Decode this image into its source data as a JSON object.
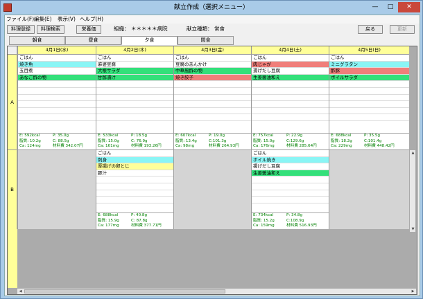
{
  "window": {
    "title": "献立作成（選択メニュー）",
    "minimize": "—",
    "maximize": "□",
    "close": "✕"
  },
  "menu": [
    "ファイル(F)",
    "編集(E)",
    "表示(V)",
    "ヘルプ(H)"
  ],
  "toolbar": {
    "register": "料理登録",
    "search": "料理検索",
    "nutrition": "栄養価",
    "org_label": "組織：",
    "org_value": "＊＊＊＊＊病院",
    "type_label": "献立種類：",
    "type_value": "常食",
    "back": "戻る",
    "update": "更新"
  },
  "tabs": [
    {
      "label": "朝食",
      "active": false
    },
    {
      "label": "昼食",
      "active": false
    },
    {
      "label": "夕食",
      "active": true
    },
    {
      "label": "間食",
      "active": false
    }
  ],
  "colors": {
    "cyan": "#8af5f5",
    "green": "#33e07a",
    "salmon": "#f07e7a",
    "yellow": "#ffff99",
    "nutrient_text": "#008000"
  },
  "days": [
    "4月1日(水)",
    "4月2日(木)",
    "4月3日(金)",
    "4月4日(土)",
    "4月5日(日)"
  ],
  "rows": [
    {
      "label": "A",
      "cells": [
        {
          "dishes": [
            {
              "name": "ごはん",
              "color": ""
            },
            {
              "name": "焼き魚",
              "color": "cyan"
            },
            {
              "name": "五目煮",
              "color": ""
            },
            {
              "name": "あなご酢の物",
              "color": "green"
            }
          ],
          "nutrients": {
            "e": "E:  592kcal",
            "p": "P:  35.0g",
            "fat": "脂質:  10.2g",
            "c": "C:  88.5g",
            "ca": "Ca:  124mg",
            "cost": "材料費 342.07円"
          }
        },
        {
          "dishes": [
            {
              "name": "ごはん",
              "color": ""
            },
            {
              "name": "麻婆豆腐",
              "color": ""
            },
            {
              "name": "大根サラダ",
              "color": "green"
            },
            {
              "name": "甘酢漬け",
              "color": "green"
            }
          ],
          "nutrients": {
            "e": "E:  533kcal",
            "p": "P:  18.5g",
            "fat": "脂質:  15.0g",
            "c": "C:  76.9g",
            "ca": "Ca:  161mg",
            "cost": "材料費 193.26円"
          }
        },
        {
          "dishes": [
            {
              "name": "ごはん",
              "color": ""
            },
            {
              "name": "豆腐のあんかけ",
              "color": ""
            },
            {
              "name": "中華風酢の物",
              "color": "green"
            },
            {
              "name": "焼き餃子",
              "color": "salmon"
            }
          ],
          "nutrients": {
            "e": "E:  607kcal",
            "p": "P:  19.0g",
            "fat": "脂質:  13.4g",
            "c": "C:101.3g",
            "ca": "Ca:   98mg",
            "cost": "材料費 264.93円"
          }
        },
        {
          "dishes": [
            {
              "name": "ごはん",
              "color": ""
            },
            {
              "name": "肉じゃが",
              "color": "salmon"
            },
            {
              "name": "揚げだし豆腐",
              "color": ""
            },
            {
              "name": "生姜醤油和え",
              "color": "green"
            }
          ],
          "nutrients": {
            "e": "E:  757kcal",
            "p": "P:  22.9g",
            "fat": "脂質:  15.0g",
            "c": "C:129.6g",
            "ca": "Ca:  176mg",
            "cost": "材料費 285.64円"
          }
        },
        {
          "dishes": [
            {
              "name": "ごはん",
              "color": ""
            },
            {
              "name": "ミニグラタン",
              "color": "cyan"
            },
            {
              "name": "酢豚",
              "color": "salmon"
            },
            {
              "name": "ボイルサラダ",
              "color": "green"
            }
          ],
          "nutrients": {
            "e": "E:  688kcal",
            "p": "P:  35.5g",
            "fat": "脂質:  18.2g",
            "c": "C:101.4g",
            "ca": "Ca:  229mg",
            "cost": "材料費 448.42円"
          }
        }
      ]
    },
    {
      "label": "B",
      "cells": [
        null,
        {
          "dishes": [
            {
              "name": "ごはん",
              "color": ""
            },
            {
              "name": "刺身",
              "color": "cyan"
            },
            {
              "name": "厚揚げの卵とじ",
              "color": "yellow"
            },
            {
              "name": "豚汁",
              "color": ""
            }
          ],
          "nutrients": {
            "e": "E:  688kcal",
            "p": "P:  40.8g",
            "fat": "脂質:  15.9g",
            "c": "C:  87.8g",
            "ca": "Ca:  177mg",
            "cost": "材料費 377.71円"
          }
        },
        null,
        {
          "dishes": [
            {
              "name": "ごはん",
              "color": ""
            },
            {
              "name": "ボイル焼き",
              "color": "cyan"
            },
            {
              "name": "揚げだし豆腐",
              "color": ""
            },
            {
              "name": "生姜醤油和え",
              "color": "green"
            }
          ],
          "nutrients": {
            "e": "E:  734kcal",
            "p": "P:  34.8g",
            "fat": "脂質:  15.2g",
            "c": "C:108.9g",
            "ca": "Ca:  159mg",
            "cost": "材料費 516.93円"
          }
        },
        null
      ]
    }
  ]
}
